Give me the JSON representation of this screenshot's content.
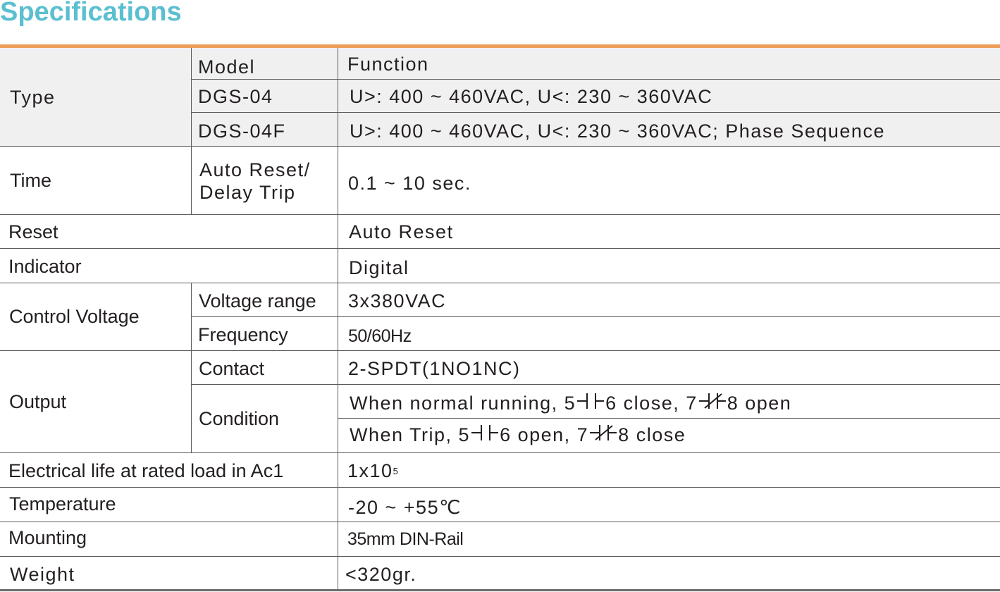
{
  "page_title": "Specifications",
  "type_section": {
    "label": "Type",
    "model_header": "Model",
    "function_header": "Function",
    "models": [
      {
        "model": "DGS-04",
        "function": "U>: 400 ~ 460VAC, U<: 230 ~ 360VAC"
      },
      {
        "model": "DGS-04F",
        "function": "U>: 400 ~ 460VAC, U<: 230 ~ 360VAC; Phase Sequence"
      }
    ]
  },
  "time": {
    "label": "Time",
    "sub_line1": "Auto Reset/",
    "sub_line2": "Delay Trip",
    "value": "0.1 ~ 10 sec."
  },
  "reset": {
    "label": "Reset",
    "value": "Auto Reset"
  },
  "indicator": {
    "label": "Indicator",
    "value": "Digital"
  },
  "control_voltage": {
    "label": "Control  Voltage",
    "range_label": "Voltage range",
    "range_value": "3x380VAC",
    "frequency_label": "Frequency",
    "frequency_value": "50/60Hz"
  },
  "output": {
    "label": "Output",
    "contact_label": "Contact",
    "contact_value": "2-SPDT(1NO1NC)",
    "condition_label": "Condition",
    "normal": {
      "prefix": "When normal running,  5",
      "mid1": "6 close, 7",
      "suffix": " 8 open"
    },
    "trip": {
      "prefix": "When Trip, 5",
      "mid1": "6 open, 7 ",
      "suffix": "8 close"
    }
  },
  "electrical_life": {
    "label": "Electrical life at rated load in Ac1",
    "value_base": "1x10",
    "value_exp": "5"
  },
  "temperature": {
    "label": "Temperature",
    "value": "-20 ~ +55℃"
  },
  "mounting": {
    "label": "Mounting",
    "value": "35mm DIN-Rail"
  },
  "weight": {
    "label": "Weight",
    "value": "<320gr."
  },
  "icons": {
    "no_contact": "normally-open-contact-icon",
    "nc_contact": "normally-closed-contact-icon"
  }
}
